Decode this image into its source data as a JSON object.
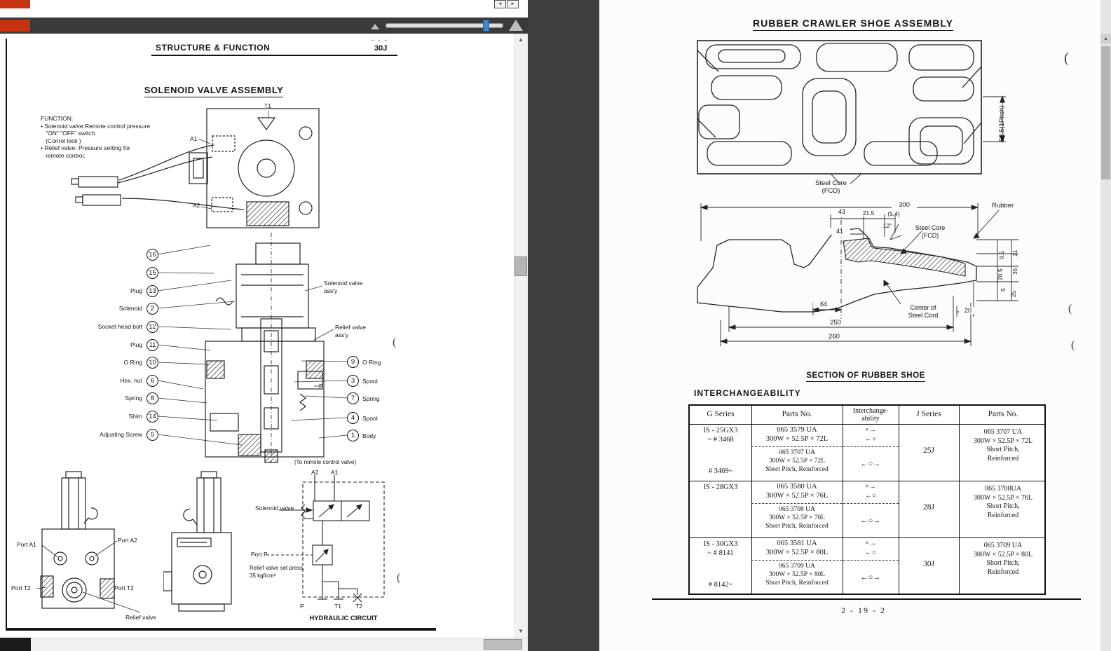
{
  "viewer": {
    "accent_red": "#c53310",
    "slider_color": "#3e87c8",
    "icons": {
      "page_prev": "◄",
      "page_next": "►",
      "scroll_up": "▲",
      "scroll_down": "▼",
      "zoom_out": "mountain-small-icon",
      "zoom_in": "mountain-large-icon"
    }
  },
  "left_page": {
    "header": {
      "dashes": "- - -",
      "title": "STRUCTURE & FUNCTION",
      "code": "30J"
    },
    "title": "SOLENOID VALVE ASSEMBLY",
    "function_text": "FUNCTION:\n• Solenoid valve:Remote control pressure\n   \"ON\" \"OFF\" switch.\n   (Conrol lock )\n• Relief valve: Pressure setting for\n   remote control.",
    "diagram_labels": {
      "t1": "T1",
      "a1": "A1",
      "a2": "A2",
      "p": "P",
      "solenoid_assy": "Solenoid valve\nass'y",
      "relief_assy": "Relief valve\nass'y"
    },
    "callouts_left": [
      {
        "num": "16",
        "label": ""
      },
      {
        "num": "15",
        "label": ""
      },
      {
        "num": "13",
        "label": "Plug"
      },
      {
        "num": "2",
        "label": "Solenoid"
      },
      {
        "num": "12",
        "label": "Socket head bolt"
      },
      {
        "num": "11",
        "label": "Plug"
      },
      {
        "num": "10",
        "label": "O Ring"
      },
      {
        "num": "6",
        "label": "Hex. nut"
      },
      {
        "num": "8",
        "label": "Spring"
      },
      {
        "num": "14",
        "label": "Shim"
      },
      {
        "num": "5",
        "label": "Adjusting Screw"
      }
    ],
    "callouts_right": [
      {
        "num": "9",
        "label": "O Ring"
      },
      {
        "num": "3",
        "label": "Spool"
      },
      {
        "num": "7",
        "label": "Spring"
      },
      {
        "num": "4",
        "label": "Spool"
      },
      {
        "num": "1",
        "label": "Body"
      }
    ],
    "bottom_views": {
      "port_a1": "Port A1",
      "port_a2": "Port A2",
      "port_t2_left": "Port T2",
      "port_t2_right": "Port T2",
      "relief_valve": "Relief valve"
    },
    "hydraulic": {
      "note": "(To remote control valve)",
      "a2": "A2",
      "a1": "A1",
      "solenoid_valve": "Solenoid valve",
      "port_p": "Port P",
      "relief_press_1": "Relief valve set press.",
      "relief_press_2": "35 kgf/cm²",
      "p": "P",
      "t1": "T1",
      "t2": "T2",
      "caption": "HYDRAULIC CIRCUIT"
    },
    "marks": [
      "(",
      "("
    ]
  },
  "right_page": {
    "title": "RUBBER CRAWLER SHOE ASSEMBLY",
    "crawler": {
      "pitch_dim": "52.5(1Pitch)",
      "steel_core": "Steel Core\n(FCD)"
    },
    "section": {
      "caption": "SECTION OF RUBBER SHOE",
      "labels": {
        "rubber": "Rubber",
        "steel_core": "Steel Core\n(FCD)",
        "center_cord": "Center of\nSteel Cord"
      },
      "dims": {
        "w300": "300",
        "w43": "43",
        "w21_5": "21.5",
        "w5_4": "(5.4)",
        "w41": "41",
        "a12": "12°",
        "h9_5": "9.5",
        "h21": "21",
        "h20_5": "20.5",
        "h35": "35",
        "h5": "5",
        "h25": "25",
        "w64": "64",
        "w20": "20",
        "w250": "250",
        "w260": "260"
      }
    },
    "table": {
      "heading": "INTERCHANGEABILITY",
      "headers": [
        "G Series",
        "Parts No.",
        "Interchange-\nability",
        "J Series",
        "Parts No."
      ],
      "groups": [
        {
          "g_top": "IS - 25GX3\n~ # 3468",
          "g_bottom": "# 3469~",
          "parts_a": "065 3579 UA\n300W × 52.5P × 72L",
          "inter_a": "×→\n←○",
          "parts_b": "065 3707 UA\n300W × 52.5P × 72L\nShort Pitch, Reinforced",
          "inter_b": "←○→",
          "j": "25J",
          "j_parts": "065 3707 UA\n300W × 52.5P × 72L\nShort Pitch,\nReinforced"
        },
        {
          "g_top": "IS - 28GX3",
          "g_bottom": "",
          "parts_a": "065 3580 UA\n300W × 52.5P × 76L",
          "inter_a": "×→\n←○",
          "parts_b": "065 3708 UA\n300W × 52.5P × 76L\nShort Pitch, Reinforced",
          "inter_b": "←○→",
          "j": "28J",
          "j_parts": "065 3708UA\n300W × 52.5P × 76L\nShort Pitch,\nReinforced"
        },
        {
          "g_top": "IS - 30GX3\n~ # 8141",
          "g_bottom": "# 8142~",
          "parts_a": "065 3581 UA\n300W × 52.5P × 80L",
          "inter_a": "×→\n←○",
          "parts_b": "065 3709 UA\n300W × 52.5P × 80L\nShort Pitch, Reinforced",
          "inter_b": "←○→",
          "j": "30J",
          "j_parts": "065 3709 UA\n300W × 52.5P × 80L\nShort Pitch,\nReinforced"
        }
      ]
    },
    "page_number": "2 - 19 - 2",
    "marks": [
      "(",
      "(",
      "("
    ]
  }
}
